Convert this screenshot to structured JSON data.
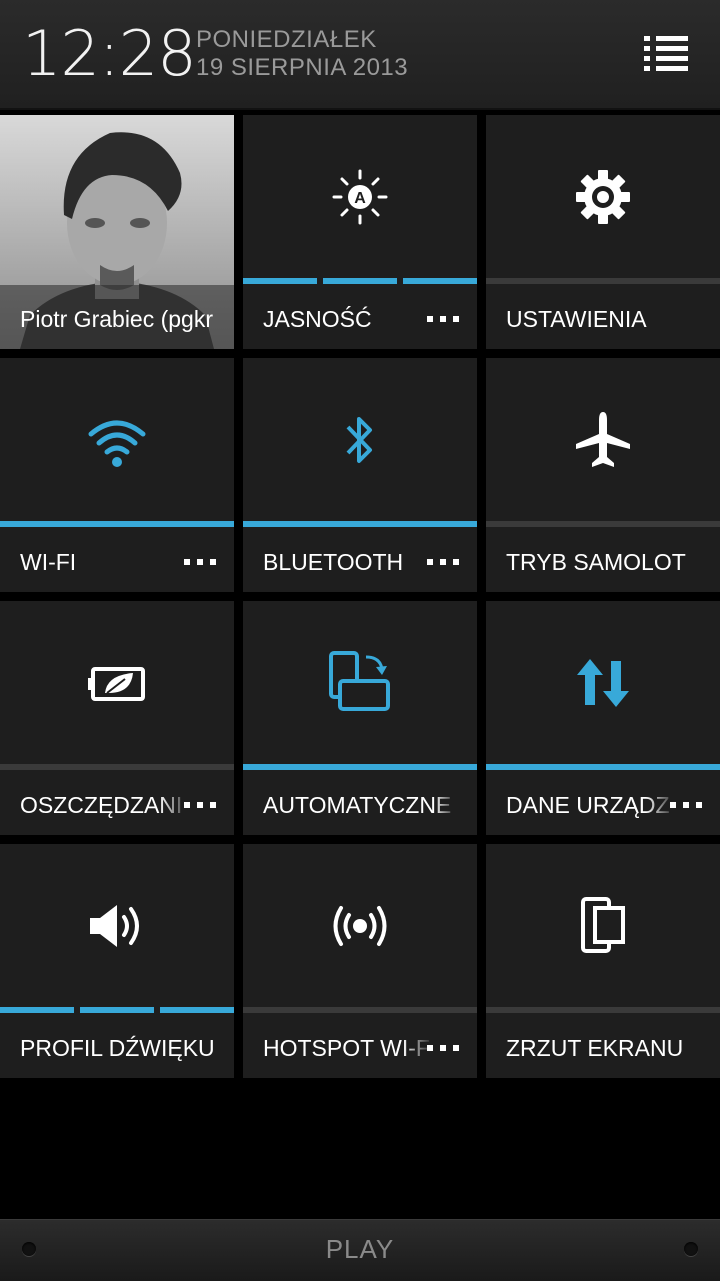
{
  "status": {
    "time": "12:28",
    "day": "PONIEDZIAŁEK",
    "date": "19 SIERPNIA 2013",
    "menu_icon": "list-menu-icon"
  },
  "tiles": [
    {
      "label": "Piotr Grabiec (pgkr",
      "icon": "profile-photo"
    },
    {
      "label": "JASNOŚĆ",
      "icon": "auto-brightness-icon",
      "more": "more-options-icon"
    },
    {
      "label": "USTAWIENIA",
      "icon": "settings-gear-icon"
    },
    {
      "label": "WI-FI",
      "icon": "wifi-icon",
      "more": "more-options-icon",
      "active": true
    },
    {
      "label": "BLUETOOTH",
      "icon": "bluetooth-icon",
      "more": "more-options-icon",
      "active": true
    },
    {
      "label": "TRYB SAMOLOT",
      "icon": "airplane-icon",
      "active": false
    },
    {
      "label": "OSZCZĘDZANI",
      "icon": "power-saver-battery-icon",
      "more": "more-options-icon",
      "active": false
    },
    {
      "label": "AUTOMATYCZNE O",
      "icon": "auto-rotate-icon",
      "active": true
    },
    {
      "label": "DANE URZĄDZ",
      "icon": "mobile-data-icon",
      "more": "more-options-icon",
      "active": true
    },
    {
      "label": "PROFIL DŹWIĘKU",
      "icon": "volume-icon"
    },
    {
      "label": "HOTSPOT WI-F",
      "icon": "hotspot-icon",
      "more": "more-options-icon",
      "active": false
    },
    {
      "label": "ZRZUT EKRANU",
      "icon": "screenshot-icon"
    }
  ],
  "levels": {
    "brightness_segments_on": 3,
    "brightness_segments_total": 3,
    "sound_segments_on": 3,
    "sound_segments_total": 3
  },
  "carrier": "PLAY",
  "colors": {
    "accent": "#38a9d9",
    "tile": "#1e1e1e",
    "background": "#000000",
    "inactive_bar": "#3a3a3a"
  }
}
